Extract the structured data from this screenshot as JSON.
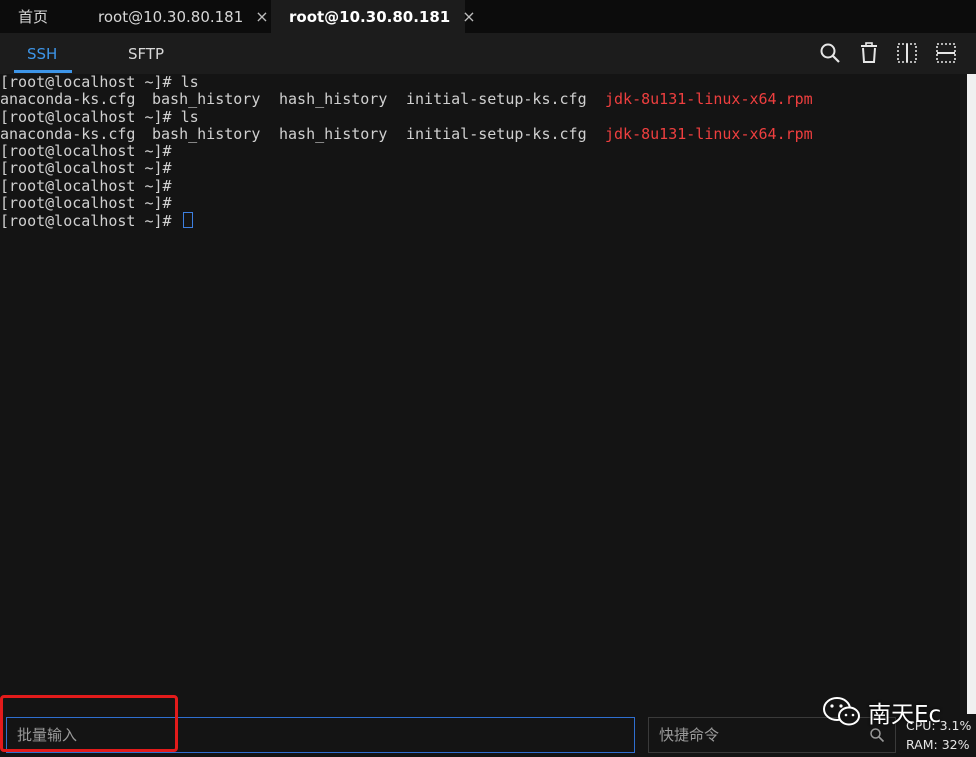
{
  "tabs": {
    "home": "首页",
    "tab1": "root@10.30.80.181",
    "tab2": "root@10.30.80.181",
    "close_glyph": "×"
  },
  "toolbar": {
    "ssh": "SSH",
    "sftp": "SFTP",
    "icons": [
      "search-icon",
      "trash-icon",
      "split-vertical-icon",
      "split-horizontal-icon"
    ],
    "accent": "#3d95e8"
  },
  "terminal": {
    "lines": [
      {
        "prompt": "[root@localhost ~]# ",
        "cmd": "ls"
      },
      {
        "files": [
          "anaconda-ks.cfg",
          "bash_history",
          "hash_history",
          "initial-setup-ks.cfg",
          "jdk-8u131-linux-x64.rpm"
        ]
      },
      {
        "prompt": "[root@localhost ~]# ",
        "cmd": "ls"
      },
      {
        "files": [
          "anaconda-ks.cfg",
          "bash_history",
          "hash_history",
          "initial-setup-ks.cfg",
          "jdk-8u131-linux-x64.rpm"
        ]
      },
      {
        "prompt": "[root@localhost ~]#",
        "cmd": ""
      },
      {
        "prompt": "[root@localhost ~]#",
        "cmd": ""
      },
      {
        "prompt": "[root@localhost ~]#",
        "cmd": ""
      },
      {
        "prompt": "[root@localhost ~]#",
        "cmd": ""
      },
      {
        "prompt": "[root@localhost ~]# ",
        "cmd": "",
        "cursor": true
      }
    ],
    "highlight_color": "#ef3f3f"
  },
  "bottom": {
    "batch_placeholder": "批量输入",
    "quick_placeholder": "快捷命令",
    "cpu": "CPU: 3.1%",
    "ram": "RAM: 32%"
  },
  "watermark": "南天Ec"
}
